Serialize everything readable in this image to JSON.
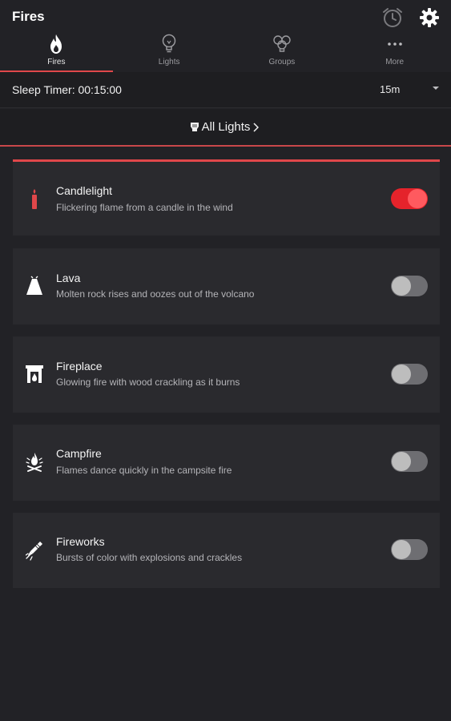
{
  "app": {
    "title": "Fires"
  },
  "header": {
    "alarm_icon": "alarm-clock-icon",
    "settings_icon": "gear-icon"
  },
  "tabs": [
    {
      "label": "Fires",
      "icon": "flame-icon",
      "active": true
    },
    {
      "label": "Lights",
      "icon": "lightbulb-icon",
      "active": false
    },
    {
      "label": "Groups",
      "icon": "bulb-group-icon",
      "active": false
    },
    {
      "label": "More",
      "icon": "more-dots-icon",
      "active": false
    }
  ],
  "sleep_timer": {
    "label": "Sleep Timer: 00:15:00",
    "selected": "15m"
  },
  "all_lights": {
    "label": "All Lights"
  },
  "fires": [
    {
      "title": "Candlelight",
      "description": "Flickering flame from a candle in the wind",
      "icon": "candle-icon",
      "enabled": true
    },
    {
      "title": "Lava",
      "description": "Molten rock rises and oozes out of the volcano",
      "icon": "volcano-icon",
      "enabled": false
    },
    {
      "title": "Fireplace",
      "description": "Glowing fire with wood crackling as it burns",
      "icon": "fireplace-icon",
      "enabled": false
    },
    {
      "title": "Campfire",
      "description": "Flames dance quickly in the campsite fire",
      "icon": "campfire-icon",
      "enabled": false
    },
    {
      "title": "Fireworks",
      "description": "Bursts of color with explosions and crackles",
      "icon": "firework-rocket-icon",
      "enabled": false
    }
  ],
  "colors": {
    "accent": "#e0474a",
    "toggle_on": "#e5232b",
    "background": "#222226",
    "card": "#2a2a2e"
  }
}
